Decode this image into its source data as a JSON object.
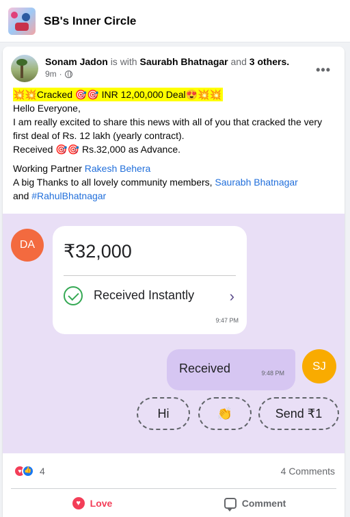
{
  "group": {
    "name": "SB's Inner Circle",
    "avatar_icon": "group-collage-icon"
  },
  "post": {
    "author": "Sonam Jadon",
    "is_with": "is with",
    "tagged": "Saurabh Bhatnagar",
    "and": "and",
    "others": "3 others.",
    "time": "9m",
    "privacy_icon": "globe-icon",
    "more": "•••",
    "headline": "💥💥Cracked 🎯🎯 INR 12,00,000 Deal😍💥💥",
    "line1": "Hello Everyone,",
    "line2": "I am really excited to share this news with all of you that cracked the very first deal of Rs. 12 lakh (yearly contract).",
    "line3": "Received 🎯🎯 Rs.32,000 as Advance.",
    "partner_prefix": "Working Partner ",
    "partner_name": "Rakesh Behera",
    "thanks_prefix": "A big Thanks to all lovely community members, ",
    "thanks_name": "Saurabh Bhatnagar",
    "thanks_and": "and ",
    "hashtag": "#RahulBhatnagar"
  },
  "chat": {
    "sender_initials": "DA",
    "amount": "₹32,000",
    "status": "Received Instantly",
    "time1": "9:47 PM",
    "reply": "Received",
    "time2": "9:48 PM",
    "me_initials": "SJ",
    "chips": [
      "Hi",
      "👏",
      "Send ₹1"
    ],
    "colors": {
      "da": "#f36a3f",
      "sj": "#f9ab00",
      "bubble": "#d6c6f2",
      "bg": "#e9dff6"
    }
  },
  "stats": {
    "reactions": "4",
    "comments": "4 Comments"
  },
  "actions": {
    "love": "Love",
    "comment": "Comment"
  }
}
